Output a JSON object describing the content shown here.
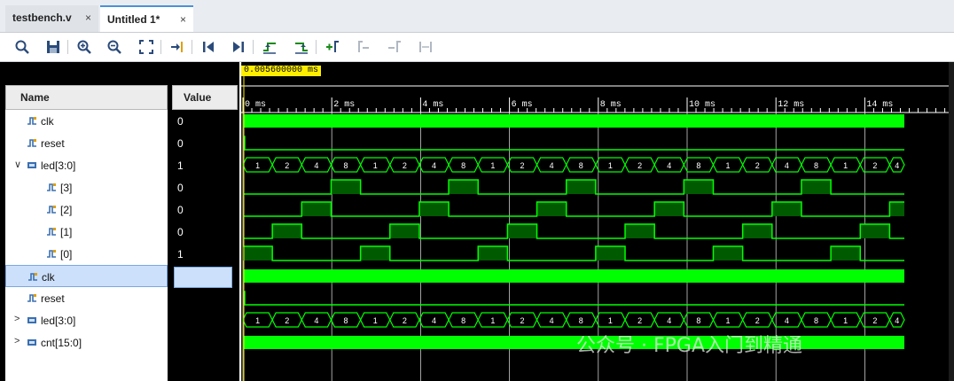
{
  "tabs": [
    {
      "label": "testbench.v",
      "close": "×"
    },
    {
      "label": "Untitled 1*",
      "close": "×"
    }
  ],
  "toolbar": {
    "icons": [
      "search-icon",
      "save-icon",
      "zoom-in-icon",
      "zoom-out-icon",
      "zoom-fit-icon",
      "go-to-cursor-icon",
      "go-to-start-icon",
      "go-to-end-icon",
      "previous-transition-icon",
      "next-transition-icon",
      "add-marker-icon",
      "previous-marker-icon",
      "next-marker-icon",
      "swap-cursors-icon"
    ]
  },
  "cursor": {
    "time": "0.005600000 ms"
  },
  "headers": {
    "name": "Name",
    "value": "Value"
  },
  "signals": [
    {
      "name": "clk",
      "value": "0",
      "expander": "",
      "indent": 0,
      "type": "bit"
    },
    {
      "name": "reset",
      "value": "0",
      "expander": "",
      "indent": 0,
      "type": "bit"
    },
    {
      "name": "led[3:0]",
      "value": "1",
      "expander": "∨",
      "indent": 0,
      "type": "bus"
    },
    {
      "name": "[3]",
      "value": "0",
      "expander": "",
      "indent": 1,
      "type": "bit"
    },
    {
      "name": "[2]",
      "value": "0",
      "expander": "",
      "indent": 1,
      "type": "bit"
    },
    {
      "name": "[1]",
      "value": "0",
      "expander": "",
      "indent": 1,
      "type": "bit"
    },
    {
      "name": "[0]",
      "value": "1",
      "expander": "",
      "indent": 1,
      "type": "bit"
    },
    {
      "name": "clk",
      "value": "",
      "expander": "",
      "indent": 0,
      "type": "bit",
      "selected": true
    },
    {
      "name": "reset",
      "value": "",
      "expander": "",
      "indent": 0,
      "type": "bit"
    },
    {
      "name": "led[3:0]",
      "value": "",
      "expander": ">",
      "indent": 0,
      "type": "bus"
    },
    {
      "name": "cnt[15:0]",
      "value": "",
      "expander": ">",
      "indent": 0,
      "type": "bus"
    }
  ],
  "timeline": {
    "labels": [
      "0 ms",
      "2 ms",
      "4 ms",
      "6 ms",
      "8 ms",
      "10 ms",
      "12 ms",
      "14 ms"
    ]
  },
  "led_sequence": [
    "1",
    "2",
    "4",
    "8",
    "1",
    "2",
    "4",
    "8",
    "1",
    "2",
    "4",
    "8",
    "1",
    "2",
    "4",
    "8",
    "1",
    "2",
    "4",
    "8",
    "1",
    "2",
    "4"
  ],
  "watermark": "公众号 · FPGA入门到精通",
  "colors": {
    "wave_green": "#00ff00",
    "dark_green": "#005a00",
    "cursor_yellow": "#ffee00",
    "selection": "#cde0fb"
  }
}
